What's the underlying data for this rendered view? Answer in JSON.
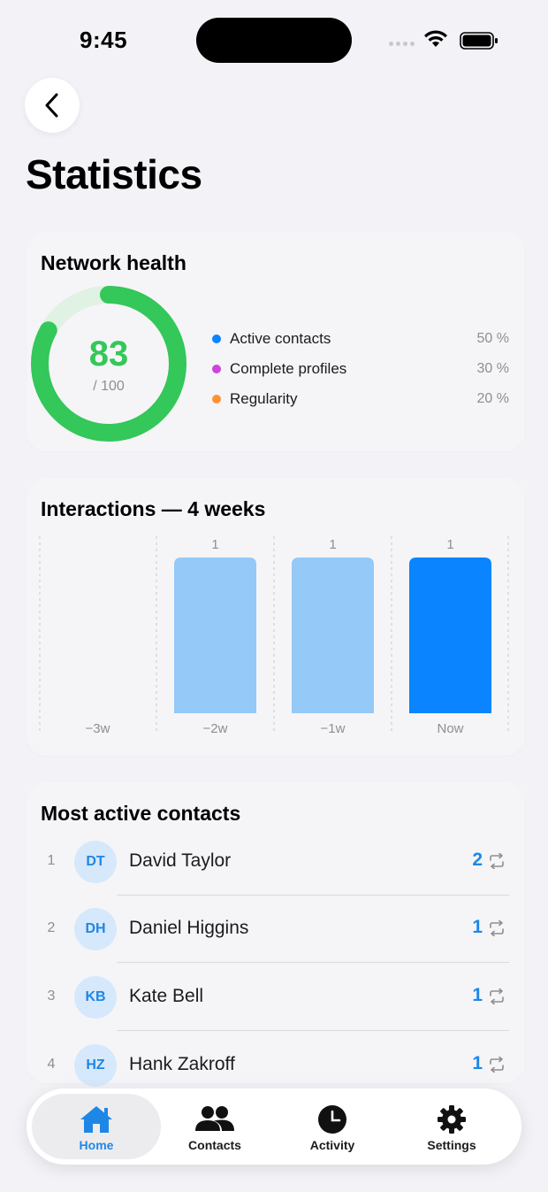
{
  "status_bar": {
    "time": "9:45"
  },
  "page": {
    "title": "Statistics"
  },
  "health": {
    "title": "Network health",
    "score": "83",
    "score_max": "/ 100",
    "score_fraction": 0.83,
    "colors": {
      "ring": "#34c759",
      "ring_track": "#dff2e3"
    },
    "legend": [
      {
        "label": "Active contacts",
        "pct": "50 %",
        "color": "#0a84ff"
      },
      {
        "label": "Complete profiles",
        "pct": "30 %",
        "color": "#cc44dd"
      },
      {
        "label": "Regularity",
        "pct": "20 %",
        "color": "#ff9230"
      }
    ]
  },
  "interactions": {
    "title": "Interactions — 4 weeks",
    "chart_data": {
      "type": "bar",
      "categories": [
        "−3w",
        "−2w",
        "−1w",
        "Now"
      ],
      "values": [
        0,
        1,
        1,
        1
      ],
      "value_labels": [
        "",
        "1",
        "1",
        "1"
      ],
      "ylim": [
        0,
        1
      ],
      "grid": "vertical dashed",
      "colors": [
        "#94c9f8",
        "#94c9f8",
        "#94c9f8",
        "#0a84ff"
      ]
    }
  },
  "active": {
    "title": "Most active contacts",
    "contacts": [
      {
        "rank": "1",
        "initials": "DT",
        "name": "David Taylor",
        "count": "2"
      },
      {
        "rank": "2",
        "initials": "DH",
        "name": "Daniel Higgins",
        "count": "1"
      },
      {
        "rank": "3",
        "initials": "KB",
        "name": "Kate Bell",
        "count": "1"
      },
      {
        "rank": "4",
        "initials": "HZ",
        "name": "Hank Zakroff",
        "count": "1"
      }
    ]
  },
  "tabs": [
    {
      "label": "Home",
      "icon": "home-icon",
      "selected": true
    },
    {
      "label": "Contacts",
      "icon": "contacts-icon",
      "selected": false
    },
    {
      "label": "Activity",
      "icon": "clock-icon",
      "selected": false
    },
    {
      "label": "Settings",
      "icon": "gear-icon",
      "selected": false
    }
  ],
  "accent": "#1e87e6"
}
